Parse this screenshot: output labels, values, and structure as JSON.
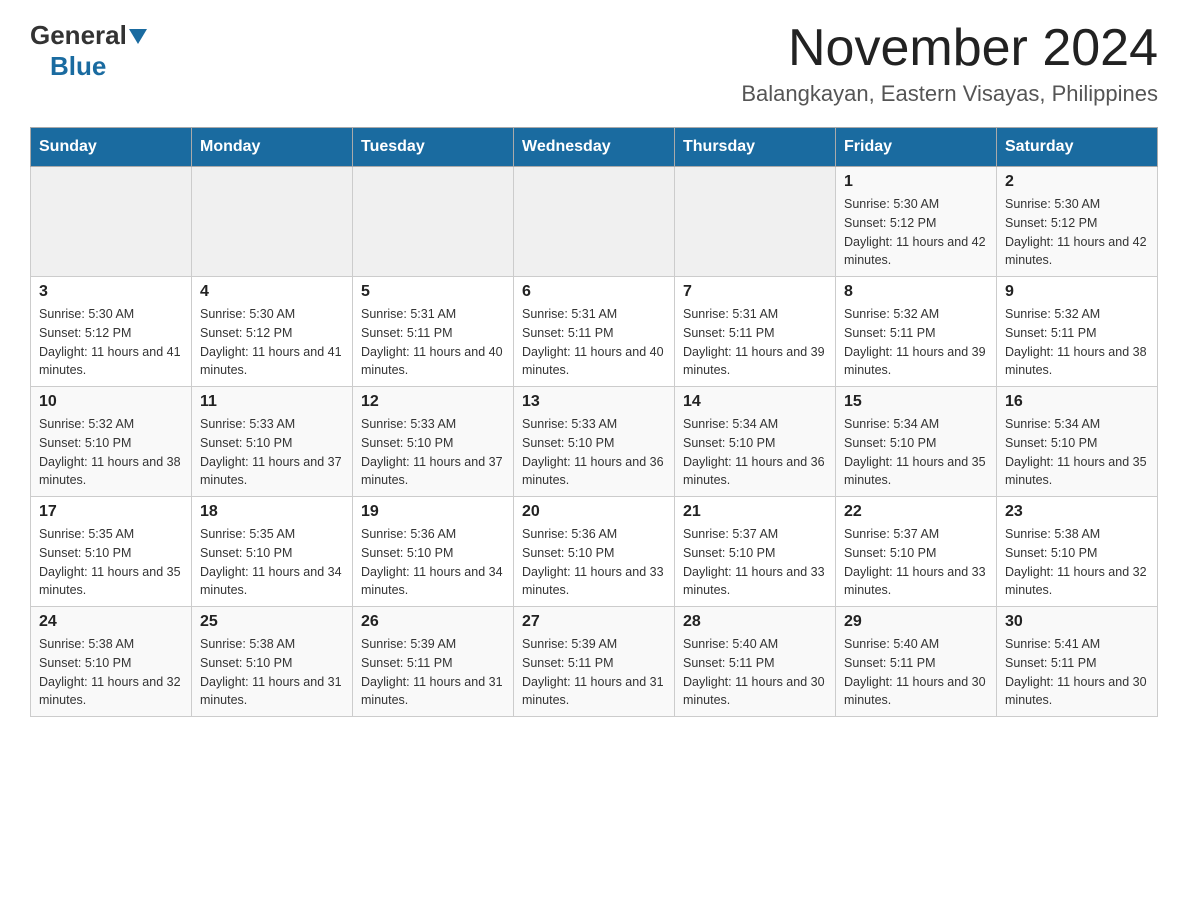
{
  "logo": {
    "general": "General",
    "blue": "Blue"
  },
  "title": {
    "month_year": "November 2024",
    "location": "Balangkayan, Eastern Visayas, Philippines"
  },
  "days_of_week": [
    "Sunday",
    "Monday",
    "Tuesday",
    "Wednesday",
    "Thursday",
    "Friday",
    "Saturday"
  ],
  "weeks": [
    [
      {
        "day": "",
        "sunrise": "",
        "sunset": "",
        "daylight": "",
        "empty": true
      },
      {
        "day": "",
        "sunrise": "",
        "sunset": "",
        "daylight": "",
        "empty": true
      },
      {
        "day": "",
        "sunrise": "",
        "sunset": "",
        "daylight": "",
        "empty": true
      },
      {
        "day": "",
        "sunrise": "",
        "sunset": "",
        "daylight": "",
        "empty": true
      },
      {
        "day": "",
        "sunrise": "",
        "sunset": "",
        "daylight": "",
        "empty": true
      },
      {
        "day": "1",
        "sunrise": "Sunrise: 5:30 AM",
        "sunset": "Sunset: 5:12 PM",
        "daylight": "Daylight: 11 hours and 42 minutes.",
        "empty": false
      },
      {
        "day": "2",
        "sunrise": "Sunrise: 5:30 AM",
        "sunset": "Sunset: 5:12 PM",
        "daylight": "Daylight: 11 hours and 42 minutes.",
        "empty": false
      }
    ],
    [
      {
        "day": "3",
        "sunrise": "Sunrise: 5:30 AM",
        "sunset": "Sunset: 5:12 PM",
        "daylight": "Daylight: 11 hours and 41 minutes.",
        "empty": false
      },
      {
        "day": "4",
        "sunrise": "Sunrise: 5:30 AM",
        "sunset": "Sunset: 5:12 PM",
        "daylight": "Daylight: 11 hours and 41 minutes.",
        "empty": false
      },
      {
        "day": "5",
        "sunrise": "Sunrise: 5:31 AM",
        "sunset": "Sunset: 5:11 PM",
        "daylight": "Daylight: 11 hours and 40 minutes.",
        "empty": false
      },
      {
        "day": "6",
        "sunrise": "Sunrise: 5:31 AM",
        "sunset": "Sunset: 5:11 PM",
        "daylight": "Daylight: 11 hours and 40 minutes.",
        "empty": false
      },
      {
        "day": "7",
        "sunrise": "Sunrise: 5:31 AM",
        "sunset": "Sunset: 5:11 PM",
        "daylight": "Daylight: 11 hours and 39 minutes.",
        "empty": false
      },
      {
        "day": "8",
        "sunrise": "Sunrise: 5:32 AM",
        "sunset": "Sunset: 5:11 PM",
        "daylight": "Daylight: 11 hours and 39 minutes.",
        "empty": false
      },
      {
        "day": "9",
        "sunrise": "Sunrise: 5:32 AM",
        "sunset": "Sunset: 5:11 PM",
        "daylight": "Daylight: 11 hours and 38 minutes.",
        "empty": false
      }
    ],
    [
      {
        "day": "10",
        "sunrise": "Sunrise: 5:32 AM",
        "sunset": "Sunset: 5:10 PM",
        "daylight": "Daylight: 11 hours and 38 minutes.",
        "empty": false
      },
      {
        "day": "11",
        "sunrise": "Sunrise: 5:33 AM",
        "sunset": "Sunset: 5:10 PM",
        "daylight": "Daylight: 11 hours and 37 minutes.",
        "empty": false
      },
      {
        "day": "12",
        "sunrise": "Sunrise: 5:33 AM",
        "sunset": "Sunset: 5:10 PM",
        "daylight": "Daylight: 11 hours and 37 minutes.",
        "empty": false
      },
      {
        "day": "13",
        "sunrise": "Sunrise: 5:33 AM",
        "sunset": "Sunset: 5:10 PM",
        "daylight": "Daylight: 11 hours and 36 minutes.",
        "empty": false
      },
      {
        "day": "14",
        "sunrise": "Sunrise: 5:34 AM",
        "sunset": "Sunset: 5:10 PM",
        "daylight": "Daylight: 11 hours and 36 minutes.",
        "empty": false
      },
      {
        "day": "15",
        "sunrise": "Sunrise: 5:34 AM",
        "sunset": "Sunset: 5:10 PM",
        "daylight": "Daylight: 11 hours and 35 minutes.",
        "empty": false
      },
      {
        "day": "16",
        "sunrise": "Sunrise: 5:34 AM",
        "sunset": "Sunset: 5:10 PM",
        "daylight": "Daylight: 11 hours and 35 minutes.",
        "empty": false
      }
    ],
    [
      {
        "day": "17",
        "sunrise": "Sunrise: 5:35 AM",
        "sunset": "Sunset: 5:10 PM",
        "daylight": "Daylight: 11 hours and 35 minutes.",
        "empty": false
      },
      {
        "day": "18",
        "sunrise": "Sunrise: 5:35 AM",
        "sunset": "Sunset: 5:10 PM",
        "daylight": "Daylight: 11 hours and 34 minutes.",
        "empty": false
      },
      {
        "day": "19",
        "sunrise": "Sunrise: 5:36 AM",
        "sunset": "Sunset: 5:10 PM",
        "daylight": "Daylight: 11 hours and 34 minutes.",
        "empty": false
      },
      {
        "day": "20",
        "sunrise": "Sunrise: 5:36 AM",
        "sunset": "Sunset: 5:10 PM",
        "daylight": "Daylight: 11 hours and 33 minutes.",
        "empty": false
      },
      {
        "day": "21",
        "sunrise": "Sunrise: 5:37 AM",
        "sunset": "Sunset: 5:10 PM",
        "daylight": "Daylight: 11 hours and 33 minutes.",
        "empty": false
      },
      {
        "day": "22",
        "sunrise": "Sunrise: 5:37 AM",
        "sunset": "Sunset: 5:10 PM",
        "daylight": "Daylight: 11 hours and 33 minutes.",
        "empty": false
      },
      {
        "day": "23",
        "sunrise": "Sunrise: 5:38 AM",
        "sunset": "Sunset: 5:10 PM",
        "daylight": "Daylight: 11 hours and 32 minutes.",
        "empty": false
      }
    ],
    [
      {
        "day": "24",
        "sunrise": "Sunrise: 5:38 AM",
        "sunset": "Sunset: 5:10 PM",
        "daylight": "Daylight: 11 hours and 32 minutes.",
        "empty": false
      },
      {
        "day": "25",
        "sunrise": "Sunrise: 5:38 AM",
        "sunset": "Sunset: 5:10 PM",
        "daylight": "Daylight: 11 hours and 31 minutes.",
        "empty": false
      },
      {
        "day": "26",
        "sunrise": "Sunrise: 5:39 AM",
        "sunset": "Sunset: 5:11 PM",
        "daylight": "Daylight: 11 hours and 31 minutes.",
        "empty": false
      },
      {
        "day": "27",
        "sunrise": "Sunrise: 5:39 AM",
        "sunset": "Sunset: 5:11 PM",
        "daylight": "Daylight: 11 hours and 31 minutes.",
        "empty": false
      },
      {
        "day": "28",
        "sunrise": "Sunrise: 5:40 AM",
        "sunset": "Sunset: 5:11 PM",
        "daylight": "Daylight: 11 hours and 30 minutes.",
        "empty": false
      },
      {
        "day": "29",
        "sunrise": "Sunrise: 5:40 AM",
        "sunset": "Sunset: 5:11 PM",
        "daylight": "Daylight: 11 hours and 30 minutes.",
        "empty": false
      },
      {
        "day": "30",
        "sunrise": "Sunrise: 5:41 AM",
        "sunset": "Sunset: 5:11 PM",
        "daylight": "Daylight: 11 hours and 30 minutes.",
        "empty": false
      }
    ]
  ]
}
